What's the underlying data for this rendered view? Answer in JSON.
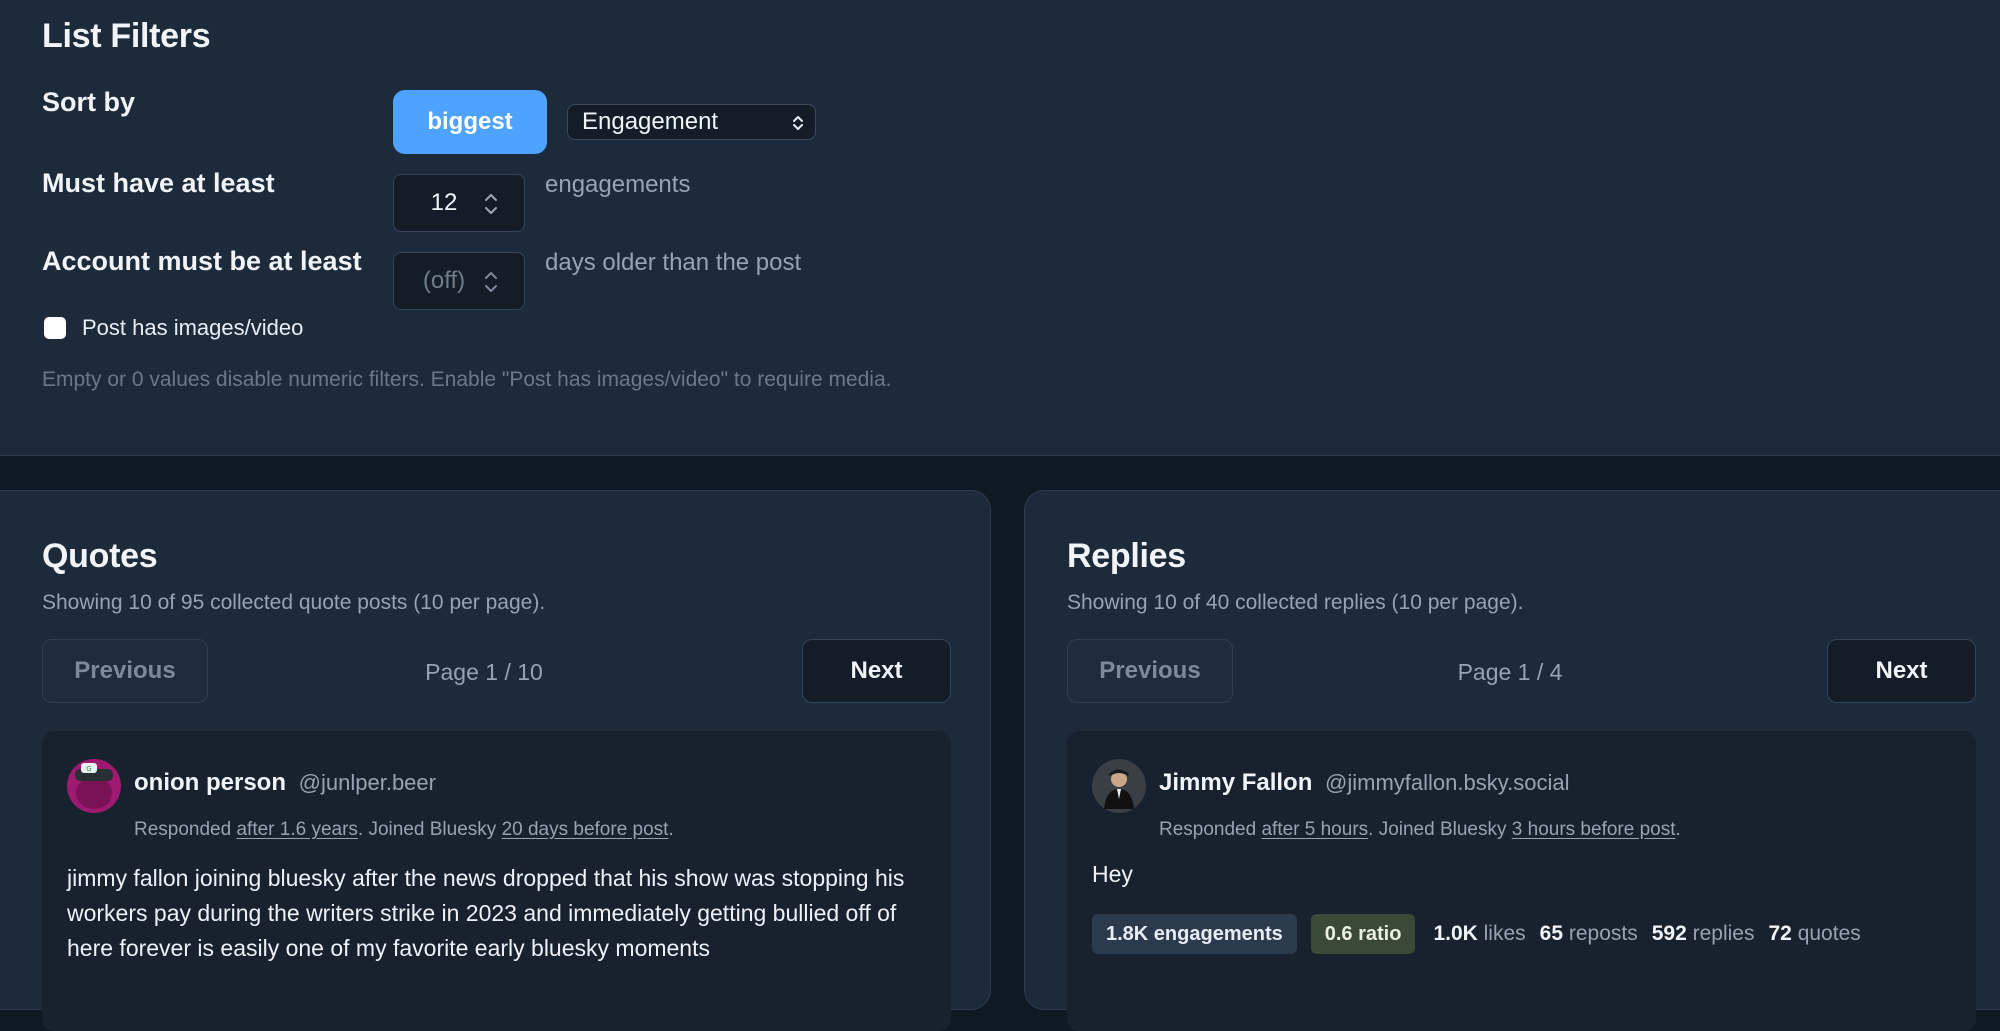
{
  "filters": {
    "title": "List Filters",
    "sort_label": "Sort by",
    "sort_direction": "biggest",
    "sort_field": "Engagement",
    "min_label": "Must have at least",
    "min_value": "12",
    "min_unit": "engagements",
    "age_label": "Account must be at least",
    "age_placeholder": "(off)",
    "age_unit": "days older than the post",
    "media_label": "Post has images/video",
    "media_checked": false,
    "hint": "Empty or 0 values disable numeric filters. Enable \"Post has images/video\" to require media."
  },
  "quotes": {
    "title": "Quotes",
    "summary": "Showing 10 of 95 collected quote posts (10 per page).",
    "prev_label": "Previous",
    "next_label": "Next",
    "page_label": "Page 1 / 10",
    "post": {
      "display_name": "onion person",
      "handle": "@junlper.beer",
      "responded_prefix": "Responded ",
      "responded_link": "after 1.6 years",
      "joined_prefix": ". Joined Bluesky ",
      "joined_link": "20 days before post",
      "joined_suffix": ".",
      "text": "jimmy fallon joining bluesky after the news dropped that his show was stopping his workers pay during the writers strike in 2023 and immediately getting bullied off of here forever is easily one of my favorite early bluesky moments"
    }
  },
  "replies": {
    "title": "Replies",
    "summary": "Showing 10 of 40 collected replies (10 per page).",
    "prev_label": "Previous",
    "next_label": "Next",
    "page_label": "Page 1 / 4",
    "post": {
      "display_name": "Jimmy Fallon",
      "handle": "@jimmyfallon.bsky.social",
      "responded_prefix": "Responded ",
      "responded_link": "after 5 hours",
      "joined_prefix": ". Joined Bluesky ",
      "joined_link": "3 hours before post",
      "joined_suffix": ".",
      "text": "Hey",
      "engagements_badge": "1.8K engagements",
      "ratio_badge": "0.6 ratio",
      "likes_value": "1.0K",
      "likes_label": "likes",
      "reposts_value": "65",
      "reposts_label": "reposts",
      "replies_value": "592",
      "replies_label": "replies",
      "quotes_value": "72",
      "quotes_label": "quotes"
    }
  },
  "colors": {
    "background": "#0f1923",
    "card": "#1d2a3a",
    "accent": "#4da3ff",
    "ratio_badge": "#3a4a36",
    "engagement_badge": "#2b3a4d"
  }
}
